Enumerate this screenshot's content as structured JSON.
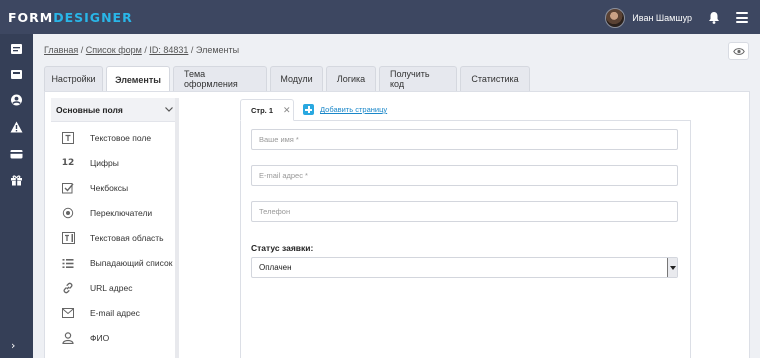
{
  "header": {
    "logo_part1": "FORM",
    "logo_part2": "DESIGNER",
    "user_name": "Иван Шамшур",
    "colors": {
      "bar": "#3d4761",
      "accent": "#29b6e8"
    }
  },
  "rail": {
    "icons": [
      "forms-icon",
      "inbox-icon",
      "user-icon",
      "warning-icon",
      "card-icon",
      "gift-icon"
    ],
    "expand_glyph": "›"
  },
  "breadcrumb": {
    "home": "Главная",
    "sep1": " / ",
    "forms_list": "Список форм",
    "sep2": " / ",
    "form_id": "ID: 84831",
    "sep3": " / ",
    "current": "Элементы"
  },
  "tabs": [
    {
      "label": "Настройки",
      "active": false
    },
    {
      "label": "Элементы",
      "active": true
    },
    {
      "label": "Тема оформления",
      "active": false
    },
    {
      "label": "Модули",
      "active": false
    },
    {
      "label": "Логика",
      "active": false
    },
    {
      "label": "Получить код",
      "active": false
    },
    {
      "label": "Статистика",
      "active": false
    }
  ],
  "elements_panel": {
    "title": "Основные поля",
    "items": [
      {
        "label": "Текстовое поле",
        "icon": "text-field-icon"
      },
      {
        "label": "Цифры",
        "icon": "numbers-icon",
        "glyph": "12"
      },
      {
        "label": "Чекбоксы",
        "icon": "checkbox-icon"
      },
      {
        "label": "Переключатели",
        "icon": "radio-icon"
      },
      {
        "label": "Текстовая область",
        "icon": "textarea-icon"
      },
      {
        "label": "Выпадающий список",
        "icon": "dropdown-list-icon"
      },
      {
        "label": "URL адрес",
        "icon": "link-icon"
      },
      {
        "label": "E-mail адрес",
        "icon": "mail-icon"
      },
      {
        "label": "ФИО",
        "icon": "person-icon"
      }
    ]
  },
  "editor": {
    "page_tab": "Стр. 1",
    "page_tab_close": "✕",
    "add_page": "Добавить страницу",
    "fields": [
      {
        "placeholder": "Ваше имя *"
      },
      {
        "placeholder": "E-mail адрес *"
      },
      {
        "placeholder": "Телефон"
      }
    ],
    "status_label": "Статус заявки:",
    "status_value": "Оплачен"
  }
}
